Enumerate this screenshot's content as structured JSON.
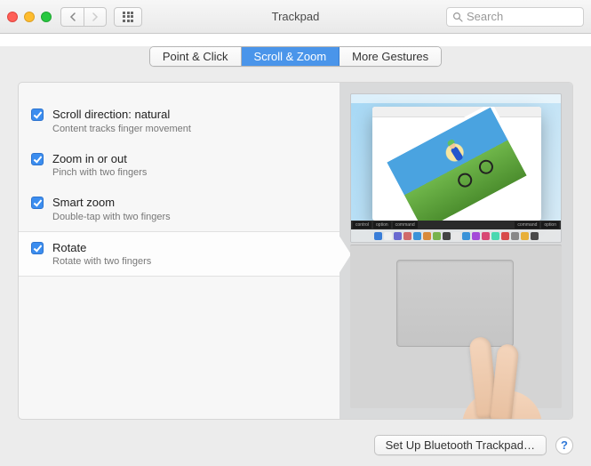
{
  "window": {
    "title": "Trackpad"
  },
  "search": {
    "placeholder": "Search"
  },
  "tabs": [
    {
      "label": "Point & Click",
      "active": false
    },
    {
      "label": "Scroll & Zoom",
      "active": true
    },
    {
      "label": "More Gestures",
      "active": false
    }
  ],
  "options": [
    {
      "title": "Scroll direction: natural",
      "subtitle": "Content tracks finger movement",
      "checked": true,
      "selected": false
    },
    {
      "title": "Zoom in or out",
      "subtitle": "Pinch with two fingers",
      "checked": true,
      "selected": false
    },
    {
      "title": "Smart zoom",
      "subtitle": "Double-tap with two fingers",
      "checked": true,
      "selected": false
    },
    {
      "title": "Rotate",
      "subtitle": "Rotate with two fingers",
      "checked": true,
      "selected": true
    }
  ],
  "modifier_keys": {
    "left1": "control",
    "left2": "option",
    "left3": "command",
    "right1": "command",
    "right2": "option"
  },
  "footer": {
    "setup_button": "Set Up Bluetooth Trackpad…",
    "help": "?"
  },
  "dock_colors": [
    "#3a7ed8",
    "#f0f0f0",
    "#6a6ad0",
    "#d06a6a",
    "#3a93d8",
    "#d88a3a",
    "#78b34e",
    "#444",
    "#e8e8e8",
    "#3a93d8",
    "#a44ad8",
    "#d84a74",
    "#4ad8b0",
    "#d84a4a",
    "#888",
    "#e8b03a",
    "#4a4a4a"
  ]
}
